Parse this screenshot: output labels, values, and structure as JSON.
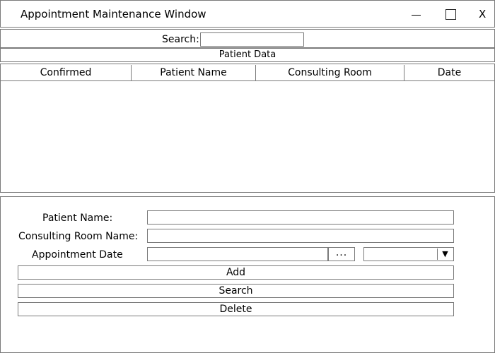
{
  "window": {
    "title": "Appointment Maintenance Window",
    "minimize_icon": "minimize-icon",
    "maximize_icon": "maximize-icon",
    "close_label": "X"
  },
  "search": {
    "label": "Search:",
    "value": ""
  },
  "section": {
    "label": "Patient Data"
  },
  "grid": {
    "columns": [
      "Confirmed",
      "Patient Name",
      "Consulting Room",
      "Date"
    ],
    "rows": []
  },
  "form": {
    "patient_name_label": "Patient Name:",
    "patient_name_value": "",
    "consulting_room_label": "Consulting Room Name:",
    "consulting_room_value": "",
    "appointment_date_label": "Appointment Date",
    "appointment_date_value": "",
    "date_picker_label": "...",
    "time_selected": "",
    "time_dropdown_icon": "triangle-down-icon",
    "add_label": "Add",
    "search_label": "Search",
    "delete_label": "Delete"
  }
}
